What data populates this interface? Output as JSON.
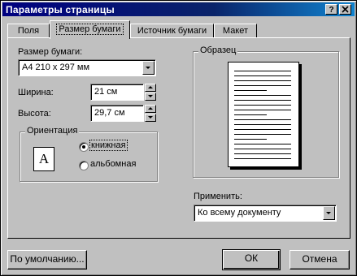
{
  "title": "Параметры страницы",
  "title_buttons": {
    "help": "?",
    "close": "x"
  },
  "tabs": [
    {
      "label": "Поля",
      "active": false
    },
    {
      "label": "Размер бумаги",
      "active": true
    },
    {
      "label": "Источник бумаги",
      "active": false
    },
    {
      "label": "Макет",
      "active": false
    }
  ],
  "paper_size": {
    "label": "Размер бумаги:",
    "value": "A4 210 x 297 мм"
  },
  "width": {
    "label": "Ширина:",
    "value": "21 см"
  },
  "height": {
    "label": "Высота:",
    "value": "29,7 см"
  },
  "orientation": {
    "label": "Ориентация",
    "options": [
      {
        "label": "книжная",
        "checked": true
      },
      {
        "label": "альбомная",
        "checked": false
      }
    ],
    "icon_letter": "A"
  },
  "preview": {
    "label": "Образец"
  },
  "apply": {
    "label": "Применить:",
    "value": "Ко всему документу"
  },
  "buttons": {
    "default": "По умолчанию...",
    "ok": "ОК",
    "cancel": "Отмена"
  }
}
